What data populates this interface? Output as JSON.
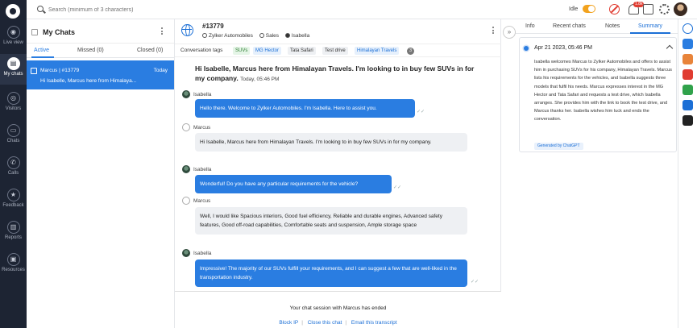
{
  "nav": {
    "items": [
      {
        "label": "Live view",
        "glyph": "◉"
      },
      {
        "label": "My chats",
        "glyph": "▤"
      },
      {
        "label": "Visitors",
        "glyph": "◎"
      },
      {
        "label": "Chats",
        "glyph": "▭"
      },
      {
        "label": "Calls",
        "glyph": "✆"
      },
      {
        "label": "Feedback",
        "glyph": "★"
      },
      {
        "label": "Reports",
        "glyph": "▥"
      },
      {
        "label": "Resources",
        "glyph": "▣"
      }
    ]
  },
  "topbar": {
    "search_placeholder": "Search (minimum of 3 characters)",
    "idle_label": "Idle",
    "notification_count": "1.8k"
  },
  "chatlist": {
    "title": "My Chats",
    "tabs": [
      "Active",
      "Missed",
      "Closed"
    ],
    "tab_counts": [
      "",
      "(0)",
      "(0)"
    ],
    "item": {
      "name": "Marcus  |  #13779",
      "time": "Today",
      "preview": "Hi Isabelle, Marcus here from Himalaya..."
    }
  },
  "conversation": {
    "id": "#13779",
    "company": "Zylker Automobiles",
    "department": "Sales",
    "agent": "Isabella",
    "tags_label": "Conversation tags",
    "tags": [
      "SUVs",
      "MG Hector",
      "Tata Safari",
      "Test drive",
      "Himalayan Travels"
    ],
    "tags_more": "3",
    "first_message": "Hi Isabelle, Marcus here from Himalayan Travels. I'm looking to in buy few SUVs in for my company.",
    "first_message_time": "Today, 05:46 PM",
    "messages": [
      {
        "sender": "Isabella",
        "type": "agent",
        "text": "Hello there. Welcome to Zylker Automobiles. I'm Isabella. Here to assist you."
      },
      {
        "sender": "Marcus",
        "type": "visitor",
        "text": "Hi Isabelle, Marcus here from Himalayan Travels. I'm looking to in buy few SUVs in for my company."
      },
      {
        "sender": "Isabella",
        "type": "agent",
        "text": "Wonderful! Do you have any particular requirements for the vehicle?"
      },
      {
        "sender": "Marcus",
        "type": "visitor",
        "text": "Well, I would like Spacious interiors, Good fuel efficiency, Reliable and durable engines, Advanced safety features, Good off-road capabilities, Comfortable seats and suspension, Ample storage space"
      },
      {
        "sender": "Isabella",
        "type": "agent",
        "text": "Impressive! The majority of our SUVs fulfill your requirements, and I can suggest a few that are well-liked in the transportation industry."
      }
    ],
    "ended_text": "Your chat session with Marcus has ended",
    "footer_links": [
      "Block IP",
      "Close this chat",
      "Email this transcript"
    ]
  },
  "infopanel": {
    "tabs": [
      "Info",
      "Recent chats",
      "Notes",
      "Summary"
    ],
    "summary_date": "Apr 21 2023, 05:46 PM",
    "summary_text": "Isabella welcomes Marcus to Zylker Automobiles and offers to assist him in purchasing SUVs for his company, Himalayan Travels. Marcus lists his requirements for the vehicles, and Isabella suggests three models that fulfil his needs. Marcus expresses interest in the MG Hector and Tata Safari and requests a test drive, which Isabella arranges. She provides him with the link to book the test drive, and Marcus thanks her. Isabella wishes him luck and ends the conversation.",
    "generated_by": "Generated by ChatGPT"
  },
  "colors": {
    "accent": "#2a7de1",
    "nav_bg": "#1d2433",
    "danger": "#e03c31",
    "idle_toggle": "#f2a21e"
  }
}
